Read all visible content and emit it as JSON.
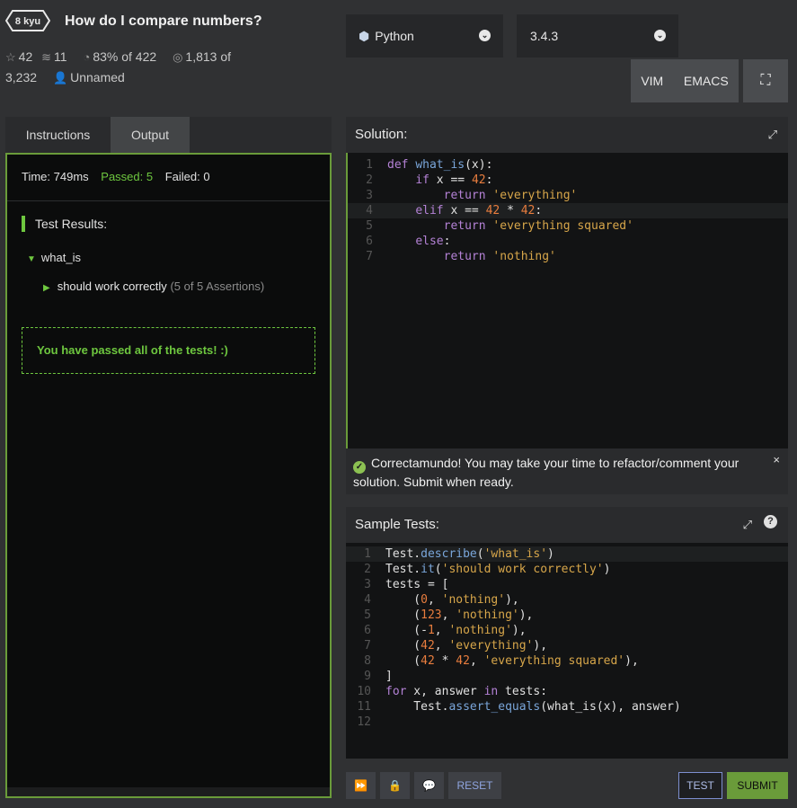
{
  "header": {
    "rank": "8 kyu",
    "title": "How do I compare numbers?",
    "stars": "42",
    "collections": "11",
    "satisfaction": "83% of 422",
    "completed": "1,813 of",
    "completed_total": "3,232",
    "author": "Unnamed"
  },
  "language": {
    "value": "Python"
  },
  "version": {
    "value": "3.4.3"
  },
  "editor_modes": {
    "vim": "VIM",
    "emacs": "EMACS"
  },
  "tabs": {
    "instructions": "Instructions",
    "output": "Output"
  },
  "output": {
    "time": "Time: 749ms",
    "passed": "Passed: 5",
    "failed": "Failed: 0",
    "test_results_label": "Test Results:",
    "describe": "what_is",
    "it": "should work correctly",
    "assertions": "(5 of 5 Assertions)",
    "pass_message": "You have passed all of the tests! :)"
  },
  "solution": {
    "title": "Solution:",
    "line_numbers": [
      "1",
      "2",
      "3",
      "4",
      "5",
      "6",
      "7"
    ]
  },
  "notice": {
    "text": "Correctamundo! You may take your time to refactor/comment your solution. Submit when ready.",
    "close": "×"
  },
  "sample_tests": {
    "title": "Sample Tests:",
    "line_numbers": [
      "1",
      "2",
      "3",
      "4",
      "5",
      "6",
      "7",
      "8",
      "9",
      "10",
      "11",
      "12"
    ],
    "help": "?"
  },
  "buttons": {
    "reset": "RESET",
    "test": "TEST",
    "submit": "SUBMIT"
  },
  "colors": {
    "accent_green": "#6ec73f",
    "panel_dark": "#0b0c0c",
    "link_blue": "#8fa5e0"
  }
}
